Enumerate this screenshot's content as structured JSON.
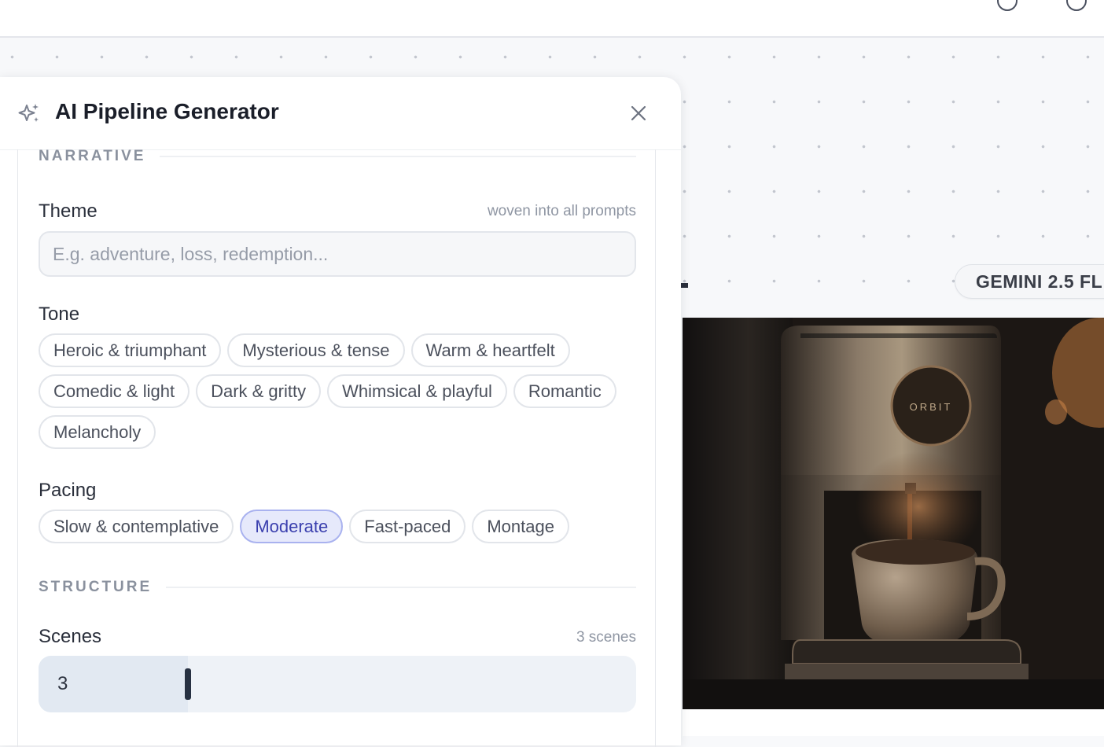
{
  "panel": {
    "title": "AI Pipeline Generator",
    "close_icon": "close-icon",
    "sparkle_icon": "sparkle-icon"
  },
  "narrative": {
    "section_label": "NARRATIVE",
    "theme": {
      "label": "Theme",
      "hint": "woven into all prompts",
      "placeholder": "E.g. adventure, loss, redemption...",
      "value": ""
    },
    "tone": {
      "label": "Tone",
      "options": [
        "Heroic & triumphant",
        "Mysterious & tense",
        "Warm & heartfelt",
        "Comedic & light",
        "Dark & gritty",
        "Whimsical & playful",
        "Romantic",
        "Melancholy"
      ],
      "selected": []
    },
    "pacing": {
      "label": "Pacing",
      "options": [
        "Slow & contemplative",
        "Moderate",
        "Fast-paced",
        "Montage"
      ],
      "selected": "Moderate"
    }
  },
  "structure": {
    "section_label": "STRUCTURE",
    "scenes": {
      "label": "Scenes",
      "hint": "3 scenes",
      "value": "3",
      "fill_fraction": 0.25
    }
  },
  "node": {
    "model_badge": "GEMINI 2.5 FL",
    "preview_image": "coffee-machine-photo",
    "brand_text": "ORBIT"
  },
  "colors": {
    "selected_chip_bg": "#e6e9fb",
    "selected_chip_border": "#a9b2ef",
    "selected_chip_text": "#3a3fae"
  }
}
